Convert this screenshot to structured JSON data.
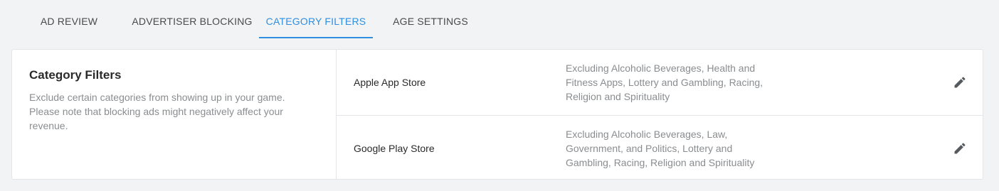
{
  "tabs": [
    {
      "label": "AD REVIEW",
      "active": false
    },
    {
      "label": "ADVERTISER BLOCKING",
      "active": false
    },
    {
      "label": "CATEGORY FILTERS",
      "active": true
    },
    {
      "label": "AGE SETTINGS",
      "active": false
    }
  ],
  "panel": {
    "title": "Category Filters",
    "description": "Exclude certain categories from showing up in your game. Please note that blocking ads might negatively affect your revenue."
  },
  "stores": [
    {
      "name": "Apple App Store",
      "exclusions": "Excluding Alcoholic Beverages, Health and Fitness Apps, Lottery and Gambling, Racing, Religion and Spirituality",
      "action_icon": "pencil-icon"
    },
    {
      "name": "Google Play Store",
      "exclusions": "Excluding Alcoholic Beverages, Law, Government, and Politics, Lottery and Gambling, Racing, Religion and Spirituality",
      "action_icon": "pencil-icon"
    }
  ],
  "colors": {
    "accent": "#2f8ee0",
    "background": "#f2f3f4",
    "card": "#ffffff",
    "border": "#e2e4e7",
    "muted_text": "#8a8d90"
  }
}
